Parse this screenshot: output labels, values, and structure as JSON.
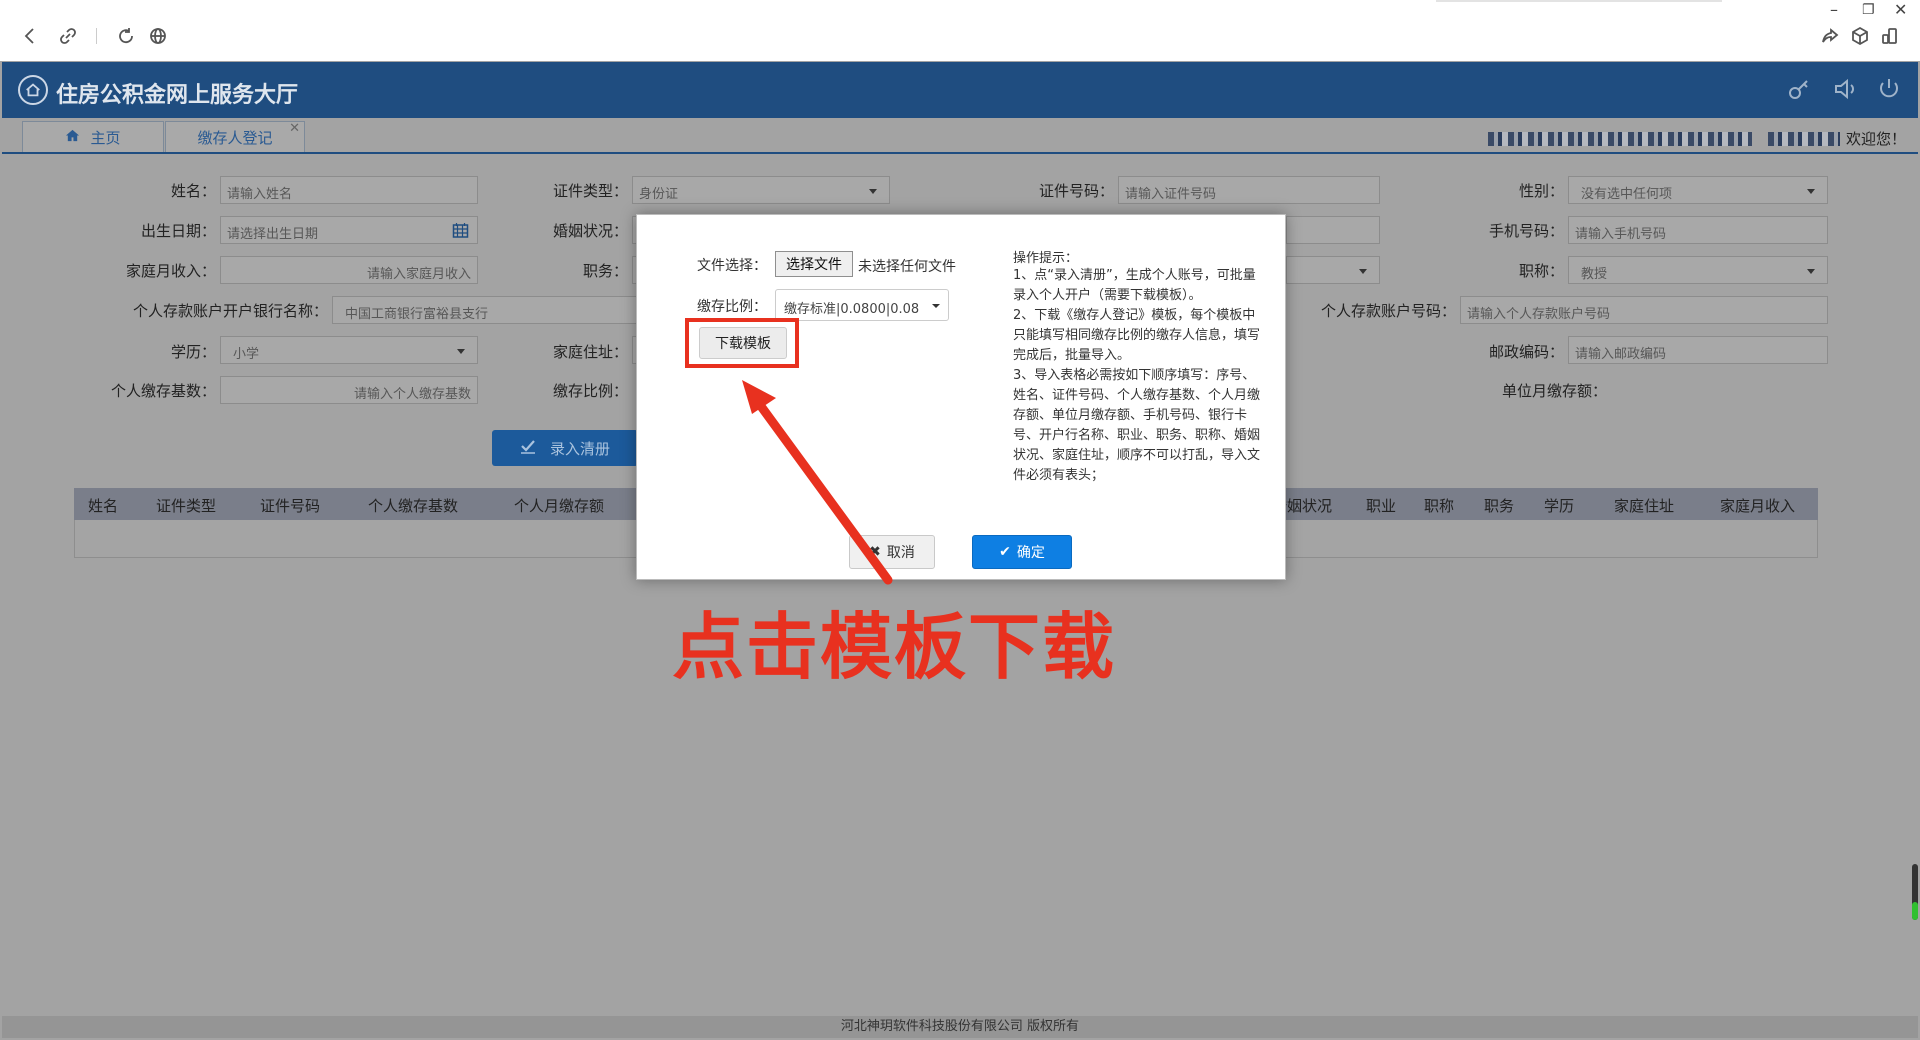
{
  "app": {
    "title": "住房公积金网上服务大厅",
    "welcome": "欢迎您！",
    "footer": "河北神玥软件科技股份有限公司 版权所有"
  },
  "tabs": [
    {
      "label": "主页"
    },
    {
      "label": "缴存人登记"
    }
  ],
  "form": {
    "name": {
      "label": "姓名：",
      "placeholder": "请输入姓名"
    },
    "id_type": {
      "label": "证件类型：",
      "value": "身份证"
    },
    "id_number": {
      "label": "证件号码：",
      "placeholder": "请输入证件号码"
    },
    "gender": {
      "label": "性别：",
      "value": "没有选中任何项"
    },
    "birth_date": {
      "label": "出生日期：",
      "placeholder": "请选择出生日期"
    },
    "marital": {
      "label": "婚姻状况："
    },
    "mobile": {
      "label": "手机号码：",
      "placeholder": "请输入手机号码"
    },
    "family_income": {
      "label": "家庭月收入：",
      "placeholder": "请输入家庭月收入"
    },
    "duty": {
      "label": "职务："
    },
    "title": {
      "label": "职称：",
      "value": "教授"
    },
    "bank_name": {
      "label": "个人存款账户开户银行名称：",
      "value": "中国工商银行富裕县支行"
    },
    "bank_account": {
      "label": "个人存款账户号码：",
      "placeholder": "请输入个人存款账户号码"
    },
    "education": {
      "label": "学历：",
      "value": "小学"
    },
    "address": {
      "label": "家庭住址："
    },
    "postcode": {
      "label": "邮政编码：",
      "placeholder": "请输入邮政编码"
    },
    "base": {
      "label": "个人缴存基数：",
      "placeholder": "请输入个人缴存基数"
    },
    "ratio": {
      "label": "缴存比例："
    },
    "unit_amount": {
      "label": "单位月缴存额："
    },
    "enter_button": "录入清册"
  },
  "grid": {
    "columns_left": [
      "姓名",
      "证件类型",
      "证件号码",
      "个人缴存基数",
      "个人月缴存额"
    ],
    "columns_right": [
      "婚姻状况",
      "职业",
      "职称",
      "职务",
      "学历",
      "家庭住址",
      "家庭月收入"
    ]
  },
  "modal": {
    "file_label": "文件选择：",
    "file_button": "选择文件",
    "file_none": "未选择任何文件",
    "ratio_label": "缴存比例：",
    "ratio_value": "缴存标准|0.0800|0.08",
    "download_button": "下载模板",
    "tips_title": "操作提示：",
    "tips_body": "1、点“录入清册”，生成个人账号，可批量录入个人开户（需要下载模板）。\n2、下载《缴存人登记》模板，每个模板中只能填写相同缴存比例的缴存人信息，填写完成后，批量导入。\n3、导入表格必需按如下顺序填写：序号、姓名、证件号码、个人缴存基数、个人月缴存额、单位月缴存额、手机号码、银行卡号、开户行名称、职业、职务、职称、婚姻状况、家庭住址，顺序不可以打乱，导入文件必须有表头；",
    "cancel": "取消",
    "ok": "确定"
  },
  "annotation": {
    "text": "点击模板下载",
    "color": "#e8311f"
  },
  "colors": {
    "header": "#1f4d80",
    "primary": "#0e7fe3",
    "overlay": "#a3a3a3"
  }
}
